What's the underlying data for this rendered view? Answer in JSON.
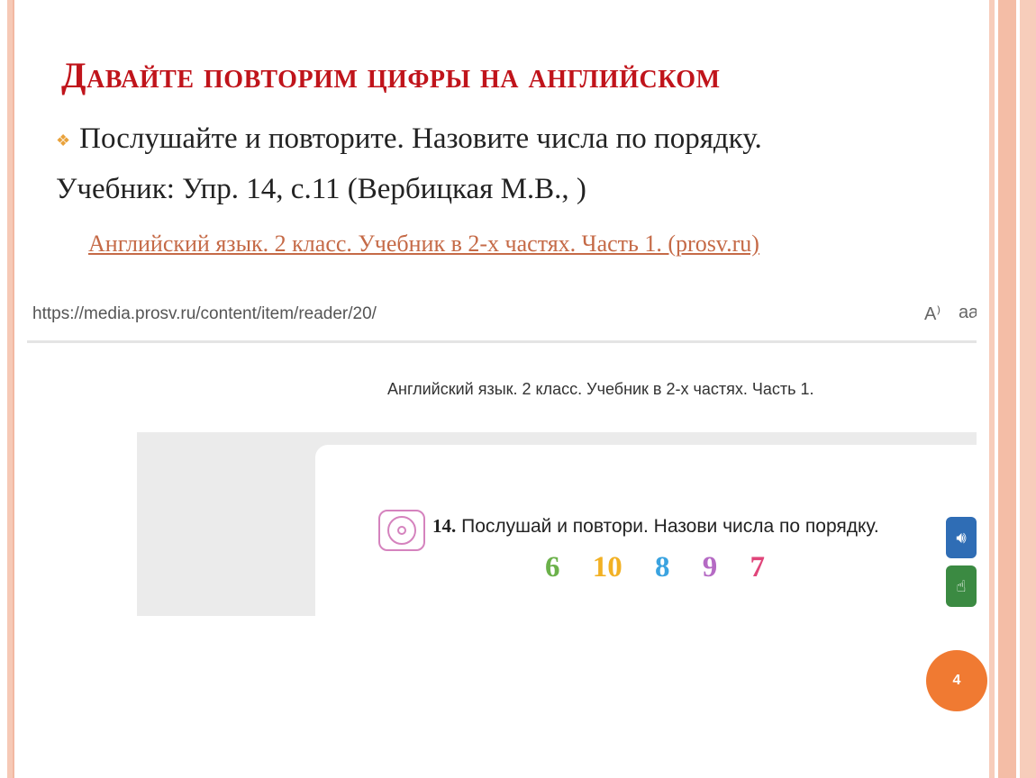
{
  "slide": {
    "title": "Давайте повторим цифры на английском",
    "bullet_text": "Послушайте и повторите. Назовите числа по порядку.",
    "textbook_line": "Учебник: Упр. 14, с.11 (Вербицкая М.В., )",
    "link_text": "Английский язык. 2 класс. Учебник в 2-х частях. Часть 1. (prosv.ru)",
    "page_number": "4"
  },
  "screenshot": {
    "url": "https://media.prosv.ru/content/item/reader/20/",
    "read_aloud_label": "A⁾",
    "text_size_label": "aæ",
    "book_title": "Английский язык. 2 класс. Учебник в 2-х частях. Часть 1.",
    "task_number": "14.",
    "task_text": "Послушай и повтори. Назови числа по порядку.",
    "numbers": [
      {
        "value": "6",
        "color": "#6bb14a"
      },
      {
        "value": "10",
        "color": "#f2b124"
      },
      {
        "value": "8",
        "color": "#3aa3e0"
      },
      {
        "value": "9",
        "color": "#b56ac4"
      },
      {
        "value": "7",
        "color": "#e0457a"
      }
    ],
    "icons": {
      "sound": "speaker-icon",
      "touch": "hand-pointer-icon",
      "disc": "audio-disc-icon"
    }
  },
  "colors": {
    "title": "#c0141b",
    "link": "#c56a47",
    "page_badge": "#f07a32",
    "bullet": "#e9a23b"
  }
}
